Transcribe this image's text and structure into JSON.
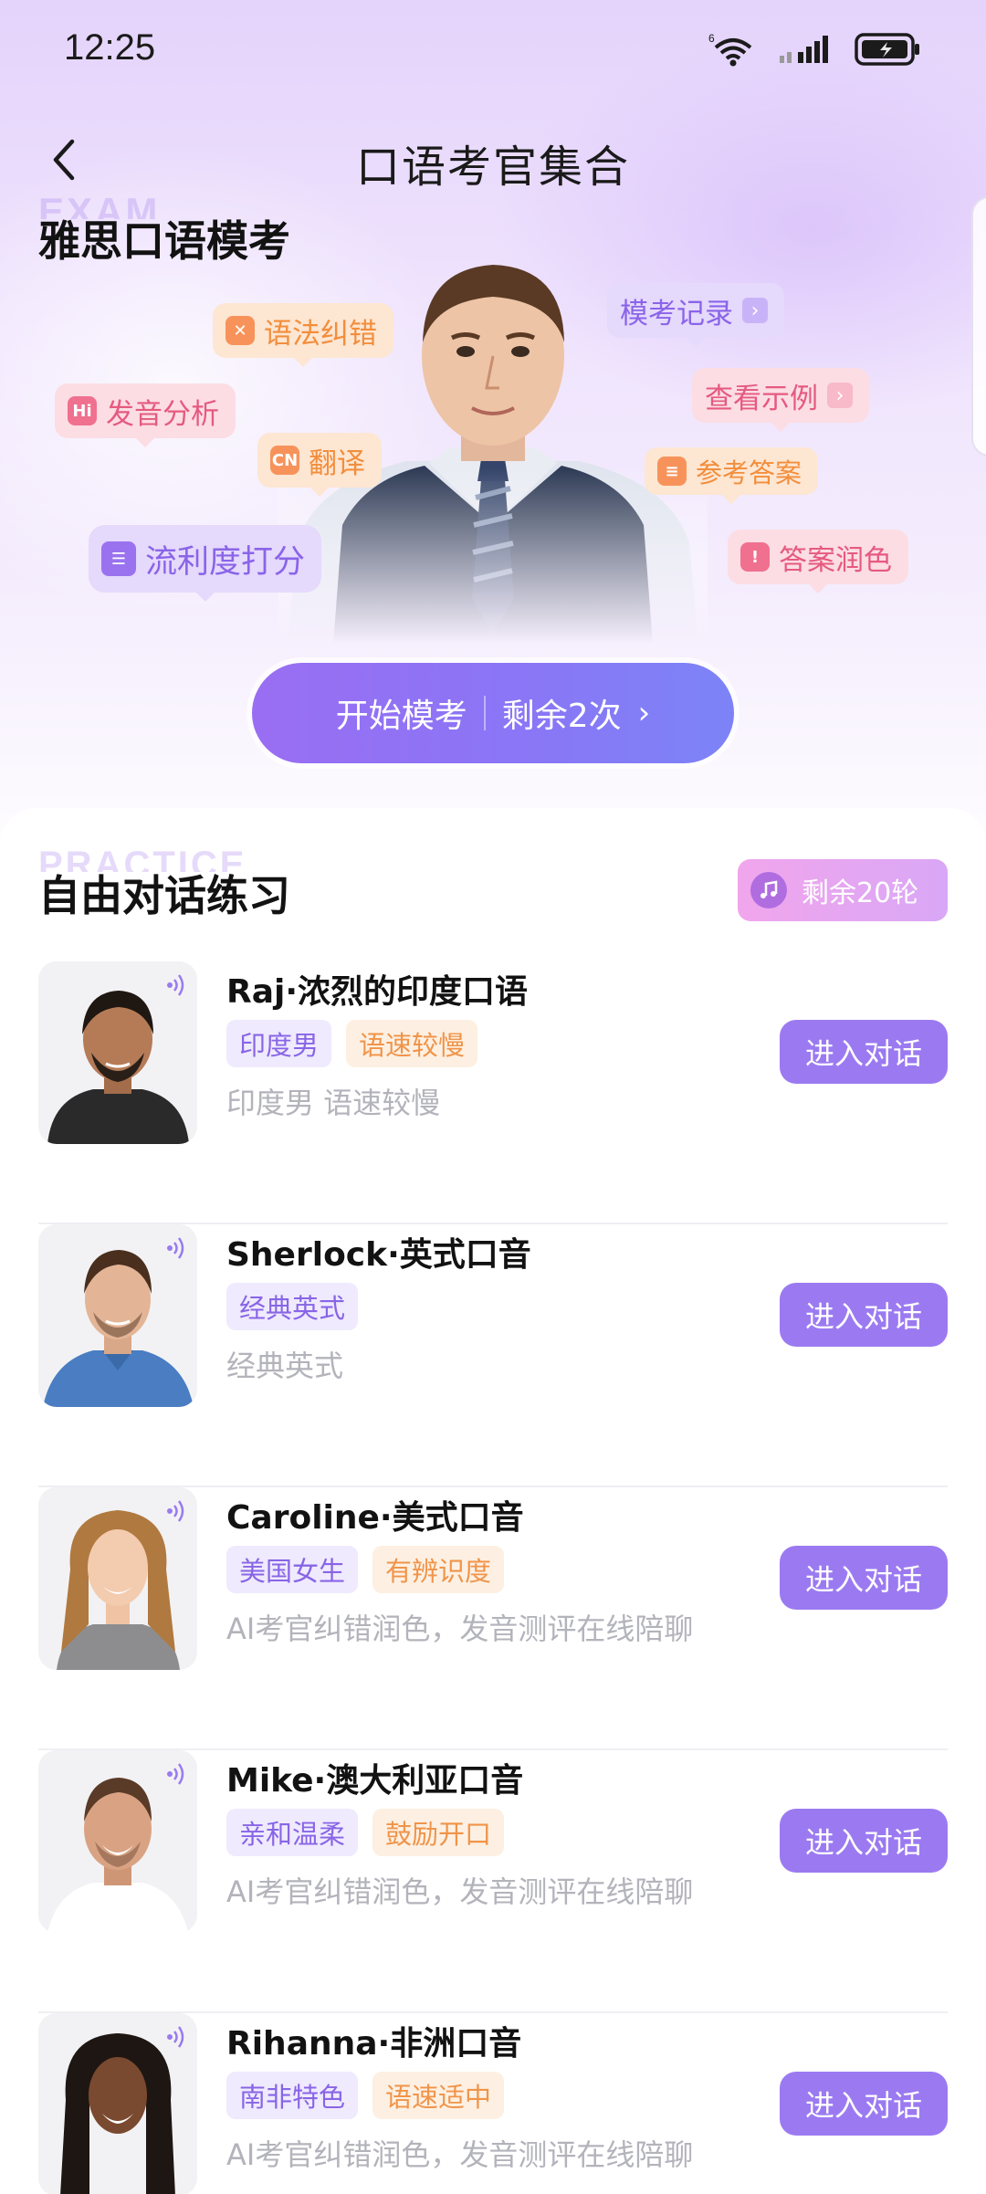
{
  "status": {
    "time": "12:25",
    "net_label": "6"
  },
  "nav": {
    "title": "口语考官集合"
  },
  "exam": {
    "watermark": "EXAM",
    "title": "雅思口语模考",
    "tags": {
      "grammar": "语法纠错",
      "record": "模考记录",
      "pronunciation": "发音分析",
      "example": "查看示例",
      "translate": "翻译",
      "reference": "参考答案",
      "fluency": "流利度打分",
      "polish": "答案润色"
    },
    "tag_icons": {
      "pronunciation": "Hi",
      "translate": "CN"
    },
    "start_button": {
      "label": "开始模考",
      "remaining": "剩余2次"
    }
  },
  "practice": {
    "watermark": "PRACTICE",
    "title": "自由对话练习",
    "remaining": "剩余20轮",
    "enter_label": "进入对话",
    "items": [
      {
        "name": "Raj·浓烈的印度口语",
        "tags": [
          "印度男",
          "语速较慢"
        ],
        "desc": "印度男 语速较慢"
      },
      {
        "name": "Sherlock·英式口音",
        "tags": [
          "经典英式"
        ],
        "desc": "经典英式"
      },
      {
        "name": "Caroline·美式口音",
        "tags": [
          "美国女生",
          "有辨识度"
        ],
        "desc": "AI考官纠错润色，发音测评在线陪聊"
      },
      {
        "name": "Mike·澳大利亚口音",
        "tags": [
          "亲和温柔",
          "鼓励开口"
        ],
        "desc": "AI考官纠错润色，发音测评在线陪聊"
      },
      {
        "name": "Rihanna·非洲口音",
        "tags": [
          "南非特色",
          "语速适中"
        ],
        "desc": "AI考官纠错润色，发音测评在线陪聊"
      }
    ]
  },
  "colors": {
    "accent": "#9b7af1",
    "tag_purple_text": "#8865e6",
    "tag_orange_text": "#f0944a"
  }
}
